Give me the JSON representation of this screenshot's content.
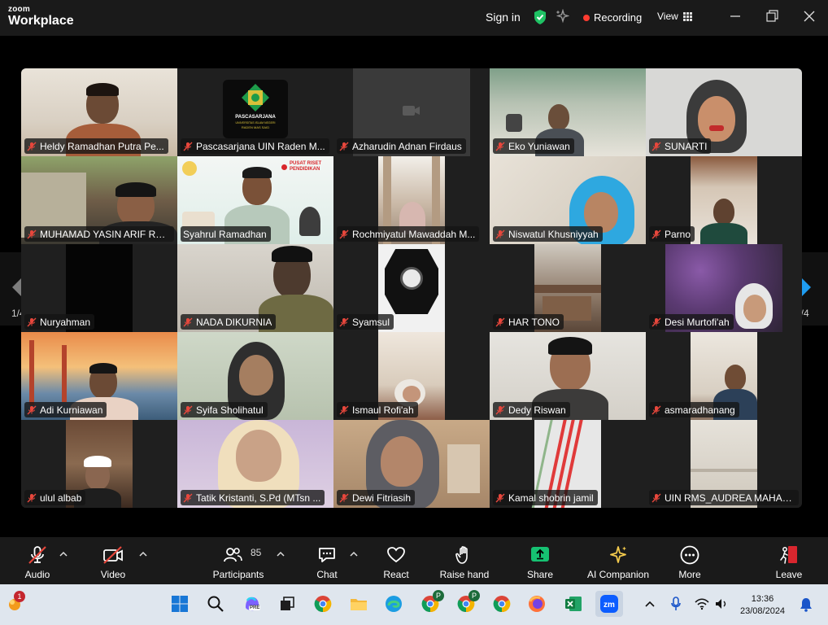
{
  "app": {
    "brand_top": "zoom",
    "brand_bottom": "Workplace"
  },
  "titlebar": {
    "sign_in": "Sign in",
    "recording": "Recording",
    "view": "View"
  },
  "pagination": {
    "left": "1/4",
    "right": "1/4"
  },
  "colors": {
    "active_speaker": "#2dd56e",
    "recording": "#ff3b30",
    "muted_mic": "#e8473c",
    "share": "#16c172"
  },
  "participants": [
    {
      "name": "Heldy Ramadhan Putra Pe..."
    },
    {
      "name": "Pascasarjana UIN Raden M..."
    },
    {
      "name": "Azharudin Adnan Firdaus"
    },
    {
      "name": "Eko Yuniawan"
    },
    {
      "name": "SUNARTI"
    },
    {
      "name": "MUHAMAD YASIN ARIF RO..."
    },
    {
      "name": "Syahrul Ramadhan"
    },
    {
      "name": "Rochmiyatul Mawaddah M..."
    },
    {
      "name": "Niswatul Khusniyyah"
    },
    {
      "name": "Parno"
    },
    {
      "name": "Nuryahman"
    },
    {
      "name": "NADA DIKURNIA"
    },
    {
      "name": "Syamsul"
    },
    {
      "name": "HAR TONO"
    },
    {
      "name": "Desi Murtofi'ah"
    },
    {
      "name": "Adi Kurniawan"
    },
    {
      "name": "Syifa Sholihatul"
    },
    {
      "name": "Ismaul Rofi'ah"
    },
    {
      "name": "Dedy Riswan"
    },
    {
      "name": "asmaradhanang"
    },
    {
      "name": "ulul albab"
    },
    {
      "name": "Tatik Kristanti, S.Pd (MTsn ..."
    },
    {
      "name": "Dewi Fitriasih"
    },
    {
      "name": "Kamal shobrin jamil"
    },
    {
      "name": "UIN RMS_AUDREA MAHAR..."
    }
  ],
  "tile_text": {
    "pascasarjana_logo": "PASCASARJANA",
    "pascasarjana_sub": "UNIVERSITAS ISLAM NEGERI",
    "pascasarjana_sub2": "RADEN MAS SAID",
    "pusat_riset_1": "PUSAT RISET",
    "pusat_riset_2": "PENDIDIKAN"
  },
  "toolbar": {
    "audio": "Audio",
    "video": "Video",
    "participants": "Participants",
    "participants_count": "85",
    "chat": "Chat",
    "react": "React",
    "raise_hand": "Raise hand",
    "share": "Share",
    "ai_companion": "AI Companion",
    "more": "More",
    "leave": "Leave"
  },
  "taskbar": {
    "notification_count": "1",
    "time": "13:36",
    "date": "23/08/2024",
    "copilot_badge": "PRE",
    "chrome_profile_badge": "P"
  }
}
